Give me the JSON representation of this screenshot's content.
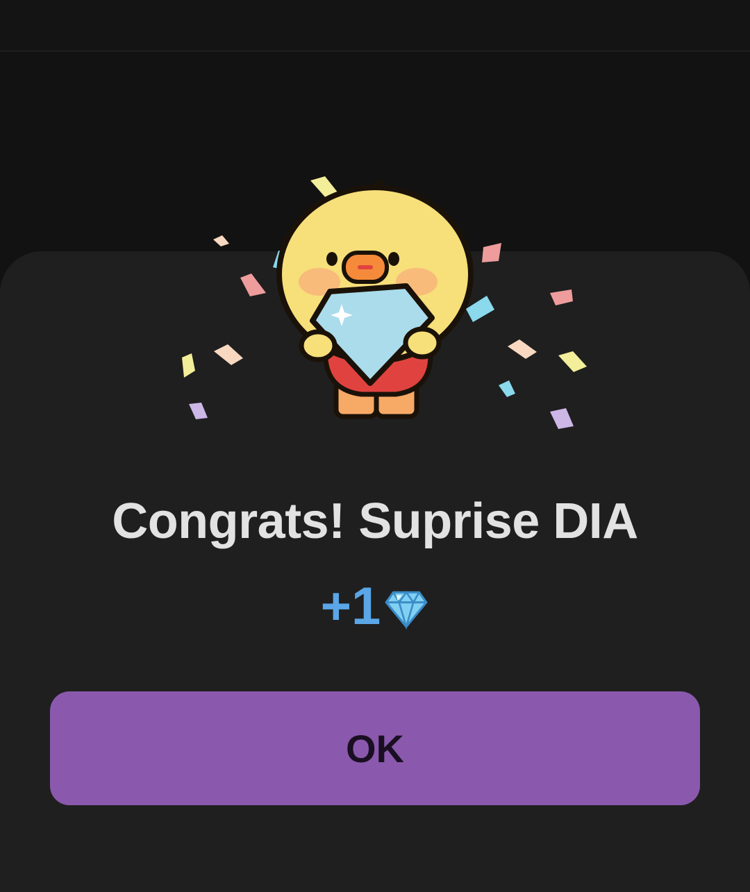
{
  "dialog": {
    "title": "Congrats! Suprise DIA",
    "reward_amount": "+1",
    "reward_icon": "diamond-icon",
    "ok_label": "OK"
  },
  "colors": {
    "background": "#121212",
    "sheet": "#1f1f1f",
    "accent_button": "#8a59ad",
    "reward_text": "#5aa6e6",
    "title_text": "#e2e2e2"
  },
  "illustration": {
    "character": "yellow-duck-mascot",
    "holding": "diamond-icon",
    "effect": "confetti"
  }
}
